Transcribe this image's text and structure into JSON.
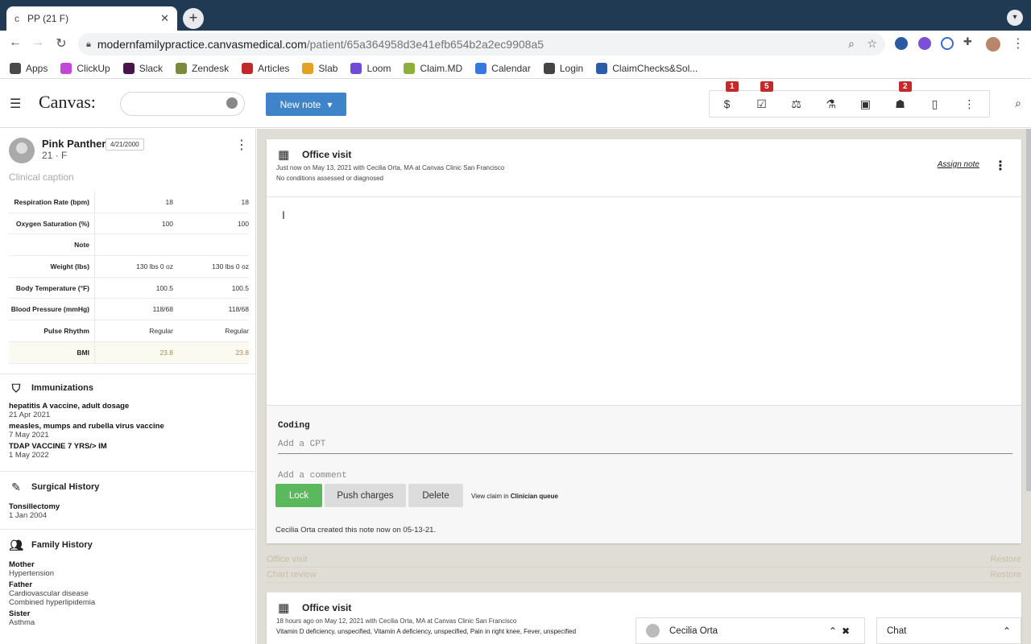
{
  "browser": {
    "tab_title": "PP (21 F)",
    "tab_favicon": "c",
    "url_host": "modernfamilypractice.canvasmedical.com",
    "url_path": "/patient/65a364958d3e41efb654b2a2ec9908a5",
    "bookmarks": [
      {
        "label": "Apps",
        "color": "#4a4a4a"
      },
      {
        "label": "ClickUp",
        "color": "#c447d8"
      },
      {
        "label": "Slack",
        "color": "#4a154b"
      },
      {
        "label": "Zendesk",
        "color": "#7a8c3a"
      },
      {
        "label": "Articles",
        "color": "#c22a2a"
      },
      {
        "label": "Slab",
        "color": "#e0a323"
      },
      {
        "label": "Loom",
        "color": "#6f4bd8"
      },
      {
        "label": "Claim.MD",
        "color": "#8bb13a"
      },
      {
        "label": "Calendar",
        "color": "#3478e0"
      },
      {
        "label": "Login",
        "color": "#444444"
      },
      {
        "label": "ClaimChecks&Sol...",
        "color": "#2b5ea8"
      }
    ]
  },
  "app": {
    "logo": "Canvas:",
    "new_note_label": "New note",
    "header_icons": [
      {
        "name": "billing-icon",
        "glyph": "$",
        "badge": "1"
      },
      {
        "name": "tasks-icon",
        "glyph": "☑",
        "badge": "5"
      },
      {
        "name": "scale-icon",
        "glyph": "⚖",
        "badge": ""
      },
      {
        "name": "lab-icon",
        "glyph": "⚗",
        "badge": ""
      },
      {
        "name": "image-icon",
        "glyph": "▣",
        "badge": ""
      },
      {
        "name": "person-icon",
        "glyph": "☗",
        "badge": "2"
      },
      {
        "name": "document-icon",
        "glyph": "▯",
        "badge": ""
      },
      {
        "name": "more-icon",
        "glyph": "⋮",
        "badge": ""
      }
    ]
  },
  "patient": {
    "name": "Pink Panther",
    "dob": "4/21/2000",
    "info": "21 · F",
    "caption_placeholder": "Clinical caption"
  },
  "vitals": [
    {
      "label": "Respiration Rate (bpm)",
      "v1": "18",
      "v2": "18"
    },
    {
      "label": "Oxygen Saturation (%)",
      "v1": "100",
      "v2": "100"
    },
    {
      "label": "Note",
      "v1": "",
      "v2": ""
    },
    {
      "label": "Weight (lbs)",
      "v1": "130 lbs 0 oz",
      "v2": "130 lbs 0 oz"
    },
    {
      "label": "Body Temperature (°F)",
      "v1": "100.5",
      "v2": "100.5"
    },
    {
      "label": "Blood Pressure (mmHg)",
      "v1": "118/68",
      "v2": "118/68"
    },
    {
      "label": "Pulse Rhythm",
      "v1": "Regular",
      "v2": "Regular"
    },
    {
      "label": "BMI",
      "v1": "23.8",
      "v2": "23.8"
    }
  ],
  "immunizations": {
    "title": "Immunizations",
    "items": [
      {
        "t": "hepatitis A vaccine, adult dosage",
        "s": "21 Apr 2021"
      },
      {
        "t": "measles, mumps and rubella virus vaccine",
        "s": "7 May 2021"
      },
      {
        "t": "TDAP VACCINE 7 YRS/> IM",
        "s": "1 May 2022"
      }
    ]
  },
  "surgical": {
    "title": "Surgical History",
    "items": [
      {
        "t": "Tonsillectomy",
        "s": "1 Jan 2004"
      }
    ]
  },
  "family": {
    "title": "Family History",
    "items": [
      {
        "t": "Mother",
        "s": "Hypertension"
      },
      {
        "t": "Father",
        "s": "Cardiovascular disease"
      },
      {
        "t": "",
        "s": "Combined hyperlipidemia"
      },
      {
        "t": "Sister",
        "s": "Asthma"
      }
    ]
  },
  "note1": {
    "title": "Office visit",
    "meta1": "Just now on May 13, 2021 with Cecilia Orta, MA at Canvas Clinic San Francisco",
    "meta2": "No conditions assessed or diagnosed",
    "assign": "Assign note",
    "coding_label": "Coding",
    "cpt_placeholder": "Add a CPT",
    "comment_placeholder": "Add a comment",
    "lock": "Lock",
    "push": "Push charges",
    "delete": "Delete",
    "view_claim_prefix": "View claim in",
    "view_claim_link": "Clinician queue",
    "created": "Cecilia Orta created this note now on 05-13-21."
  },
  "deleted_rows": [
    {
      "label": "Office visit",
      "action": "Restore"
    },
    {
      "label": "Chart review",
      "action": "Restore"
    }
  ],
  "note2": {
    "title": "Office visit",
    "meta1": "18 hours ago on May 12, 2021 with Cecilia Orta, MA at Canvas Clinic San Francisco",
    "meta2": "Vitamin D deficiency, unspecified, Vitamin A deficiency, unspecified, Pain in right knee, Fever, unspecified"
  },
  "chat": {
    "user": "Cecilia Orta",
    "label": "Chat"
  },
  "colors": {
    "lock": "#5cb85c",
    "new_note": "#3f84c9",
    "badge": "#c52a2a"
  }
}
